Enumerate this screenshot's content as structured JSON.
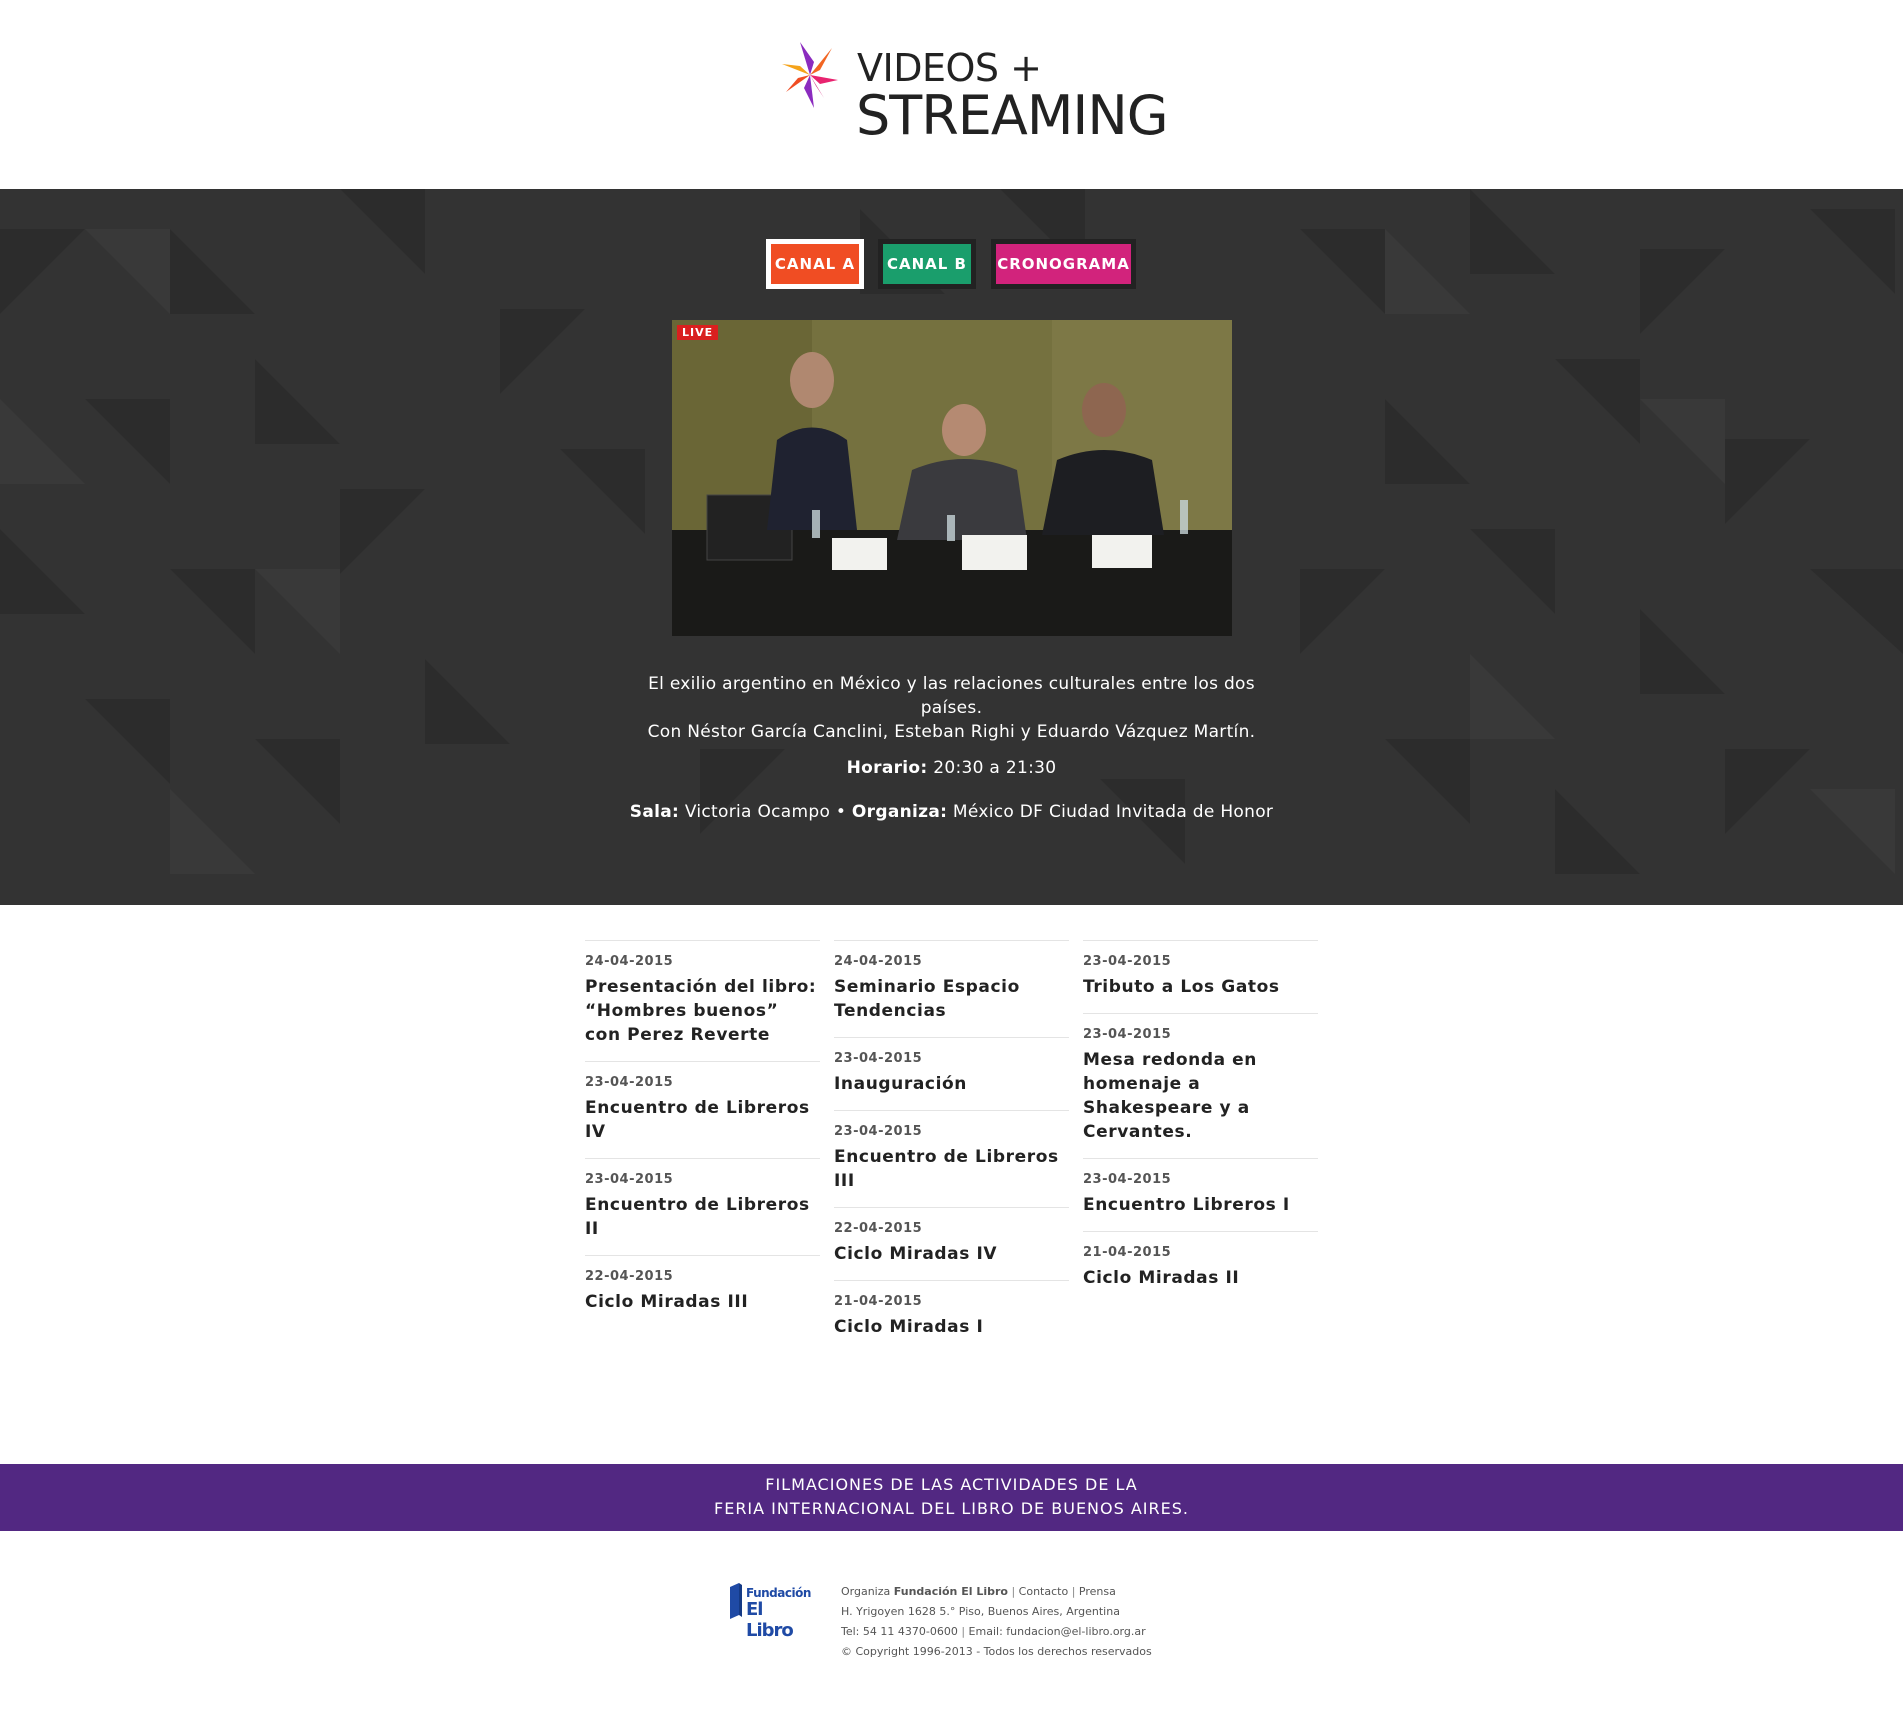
{
  "brand": {
    "line1": "VIDEOS +",
    "line2": "STREAMING"
  },
  "tabs": [
    {
      "label": "CANAL A",
      "color": "#f04d23",
      "active": true
    },
    {
      "label": "CANAL B",
      "color": "#1a9e6c",
      "active": false
    },
    {
      "label": "CRONOGRAMA",
      "color": "#d2237c",
      "active": false
    }
  ],
  "player": {
    "live_badge": "LIVE"
  },
  "event": {
    "title_line1": "El exilio argentino en México y las relaciones culturales entre los dos países.",
    "title_line2": "Con Néstor García Canclini, Esteban Righi y Eduardo Vázquez Martín.",
    "hours_label": "Horario:",
    "hours_value": "20:30 a 21:30",
    "room_label": "Sala:",
    "room_value": "Victoria Ocampo",
    "separator": "•",
    "organizer_label": "Organiza:",
    "organizer_value": "México DF Ciudad Invitada de Honor"
  },
  "videos": {
    "col1": [
      {
        "date": "24-04-2015",
        "title": "Presentación del libro: “Hombres buenos” con Perez Reverte"
      },
      {
        "date": "23-04-2015",
        "title": "Encuentro de Libreros IV"
      },
      {
        "date": "23-04-2015",
        "title": "Encuentro de Libreros II"
      },
      {
        "date": "22-04-2015",
        "title": "Ciclo Miradas III"
      }
    ],
    "col2": [
      {
        "date": "24-04-2015",
        "title": "Seminario Espacio Tendencias"
      },
      {
        "date": "23-04-2015",
        "title": "Inauguración"
      },
      {
        "date": "23-04-2015",
        "title": "Encuentro de Libreros III"
      },
      {
        "date": "22-04-2015",
        "title": "Ciclo Miradas IV"
      },
      {
        "date": "21-04-2015",
        "title": "Ciclo Miradas I"
      }
    ],
    "col3": [
      {
        "date": "23-04-2015",
        "title": "Tributo a Los Gatos"
      },
      {
        "date": "23-04-2015",
        "title": "Mesa redonda en homenaje a Shakespeare y a Cervantes."
      },
      {
        "date": "23-04-2015",
        "title": "Encuentro Libreros I"
      },
      {
        "date": "21-04-2015",
        "title": "Ciclo Miradas II"
      }
    ]
  },
  "banner": {
    "line1": "FILMACIONES DE LAS ACTIVIDADES DE LA",
    "line2": "FERIA INTERNACIONAL DEL LIBRO DE BUENOS AIRES."
  },
  "footer": {
    "logo_line1": "Fundación",
    "logo_line2": "El Libro",
    "organiza_prefix": "Organiza",
    "organiza_name": "Fundación El Libro",
    "contact_link": "Contacto",
    "press_link": "Prensa",
    "pipe": "|",
    "address": "H. Yrigoyen 1628 5.° Piso, Buenos Aires, Argentina",
    "phone": "Tel: 54 11 4370-0600",
    "email": "Email: fundacion@el-libro.org.ar",
    "copyright": "© Copyright 1996-2013 - Todos los derechos reservados"
  },
  "colors": {
    "stage_bg": "#333333",
    "banner_bg": "#522882",
    "tab_a": "#f04d23",
    "tab_b": "#1a9e6c",
    "tab_c": "#d2237c",
    "live": "#d9201f"
  }
}
